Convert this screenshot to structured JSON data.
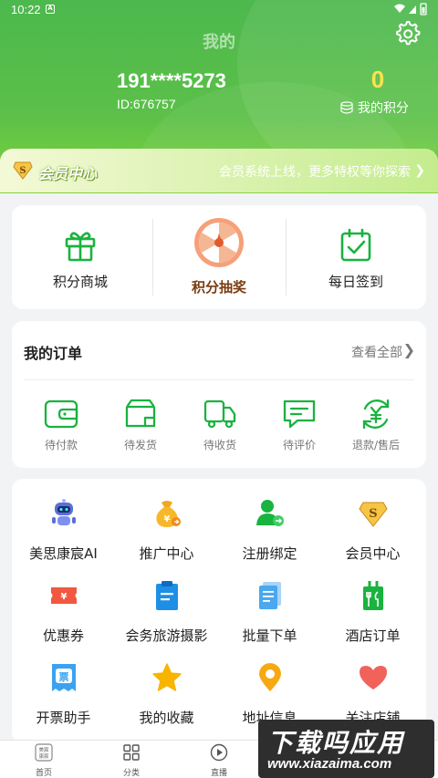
{
  "status_bar": {
    "time": "10:22",
    "notif": "A"
  },
  "header": {
    "title": "我的",
    "phone": "191****5273",
    "uid": "ID:676757",
    "points_value": "0",
    "points_label": "我的积分"
  },
  "member_banner": {
    "title": "会员中心",
    "text": "会员系统上线，更多特权等你探索",
    "badge_letter": "S"
  },
  "quick_actions": [
    {
      "label": "积分商城",
      "icon": "gift-icon"
    },
    {
      "label": "积分抽奖",
      "icon": "lottery-wheel-icon"
    },
    {
      "label": "每日签到",
      "icon": "calendar-check-icon"
    }
  ],
  "orders": {
    "title": "我的订单",
    "view_all": "查看全部",
    "items": [
      {
        "label": "待付款",
        "icon": "wallet-icon"
      },
      {
        "label": "待发货",
        "icon": "box-icon"
      },
      {
        "label": "待收货",
        "icon": "delivery-truck-icon"
      },
      {
        "label": "待评价",
        "icon": "comment-icon"
      },
      {
        "label": "退款/售后",
        "icon": "refund-icon"
      }
    ]
  },
  "services": [
    {
      "label": "美思康宸AI",
      "icon": "robot-icon"
    },
    {
      "label": "推广中心",
      "icon": "money-bag-icon"
    },
    {
      "label": "注册绑定",
      "icon": "user-bind-icon"
    },
    {
      "label": "会员中心",
      "icon": "member-badge-icon"
    },
    {
      "label": "优惠券",
      "icon": "coupon-icon"
    },
    {
      "label": "会务旅游摄影",
      "icon": "clipboard-icon"
    },
    {
      "label": "批量下单",
      "icon": "document-stack-icon"
    },
    {
      "label": "酒店订单",
      "icon": "restaurant-icon"
    },
    {
      "label": "开票助手",
      "icon": "ticket-icon"
    },
    {
      "label": "我的收藏",
      "icon": "star-icon"
    },
    {
      "label": "地址信息",
      "icon": "location-pin-icon"
    },
    {
      "label": "关注店铺",
      "icon": "heart-icon"
    }
  ],
  "bottom_nav": [
    {
      "label": "首页",
      "icon": "home-logo-icon",
      "logo_text": "美宸\n康宸"
    },
    {
      "label": "分类",
      "icon": "grid-icon"
    },
    {
      "label": "直播",
      "icon": "play-icon"
    }
  ],
  "watermark": {
    "line1": "下载吗应用",
    "line2": "www.xiazaima.com"
  },
  "colors": {
    "brand_green": "#4cb84d",
    "accent_yellow": "#ffe24a",
    "icon_green": "#19b33f",
    "lottery_brown": "#7a3d10"
  }
}
